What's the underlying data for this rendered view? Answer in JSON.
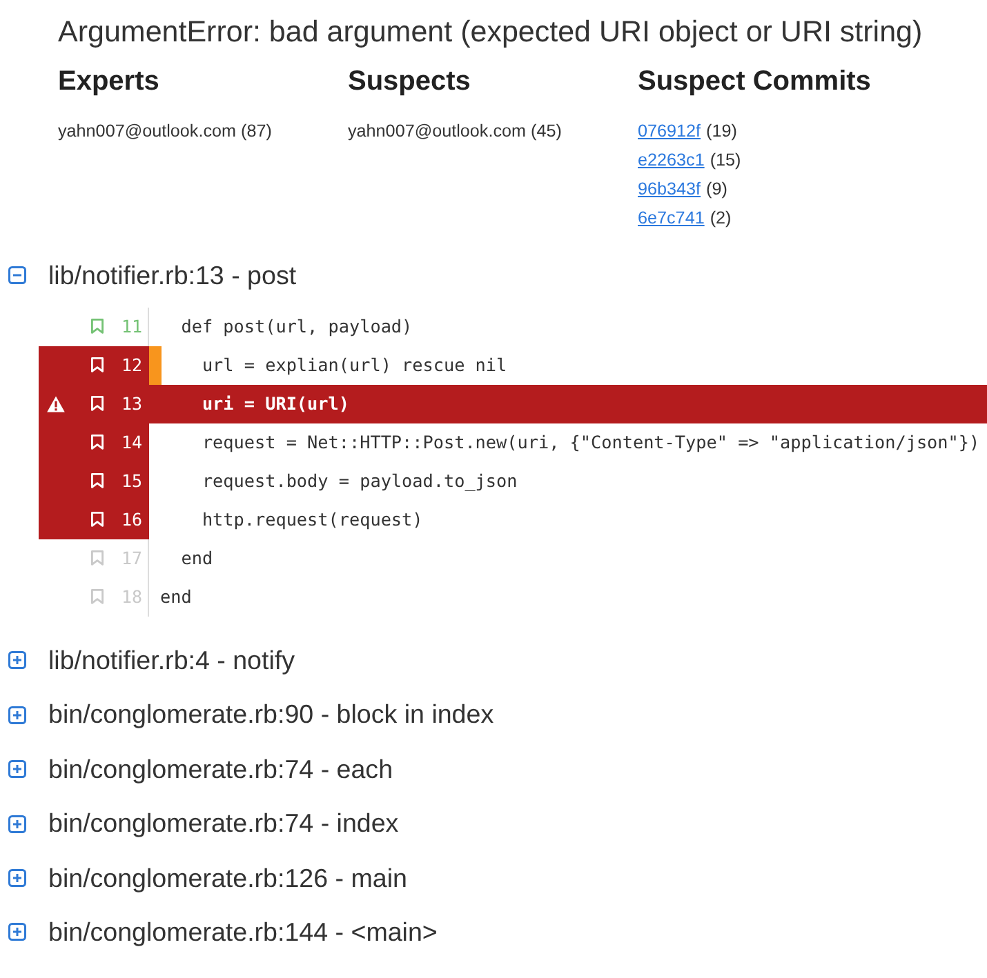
{
  "error": {
    "title": "ArgumentError: bad argument (expected URI object or URI string)"
  },
  "summary": {
    "experts": {
      "heading": "Experts",
      "entries": [
        "yahn007@outlook.com (87)"
      ]
    },
    "suspects": {
      "heading": "Suspects",
      "entries": [
        "yahn007@outlook.com (45)"
      ]
    },
    "suspect_commits": {
      "heading": "Suspect Commits",
      "entries": [
        {
          "hash": "076912f",
          "count": "(19)"
        },
        {
          "hash": "e2263c1",
          "count": "(15)"
        },
        {
          "hash": "96b343f",
          "count": "(9)"
        },
        {
          "hash": "6e7c741",
          "count": "(2)"
        }
      ]
    }
  },
  "frames": [
    {
      "title": "lib/notifier.rb:13 - post",
      "expanded": true,
      "lines": [
        {
          "number": "11",
          "code": "  def post(url, payload)",
          "kind": "covered",
          "error": false,
          "changed": false
        },
        {
          "number": "12",
          "code": "    url = explian(url) rescue nil",
          "kind": "suspect",
          "error": false,
          "changed": true
        },
        {
          "number": "13",
          "code": "    uri = URI(url)",
          "kind": "suspect",
          "error": true,
          "changed": false
        },
        {
          "number": "14",
          "code": "    request = Net::HTTP::Post.new(uri, {\"Content-Type\" => \"application/json\"})",
          "kind": "suspect",
          "error": false,
          "changed": false
        },
        {
          "number": "15",
          "code": "    request.body = payload.to_json",
          "kind": "suspect",
          "error": false,
          "changed": false
        },
        {
          "number": "16",
          "code": "    http.request(request)",
          "kind": "suspect",
          "error": false,
          "changed": false
        },
        {
          "number": "17",
          "code": "  end",
          "kind": "plain",
          "error": false,
          "changed": false
        },
        {
          "number": "18",
          "code": "end",
          "kind": "plain",
          "error": false,
          "changed": false
        }
      ]
    },
    {
      "title": "lib/notifier.rb:4 - notify",
      "expanded": false
    },
    {
      "title": "bin/conglomerate.rb:90 - block in index",
      "expanded": false
    },
    {
      "title": "bin/conglomerate.rb:74 - each",
      "expanded": false
    },
    {
      "title": "bin/conglomerate.rb:74 - index",
      "expanded": false
    },
    {
      "title": "bin/conglomerate.rb:126 - main",
      "expanded": false
    },
    {
      "title": "bin/conglomerate.rb:144 - <main>",
      "expanded": false
    }
  ]
}
